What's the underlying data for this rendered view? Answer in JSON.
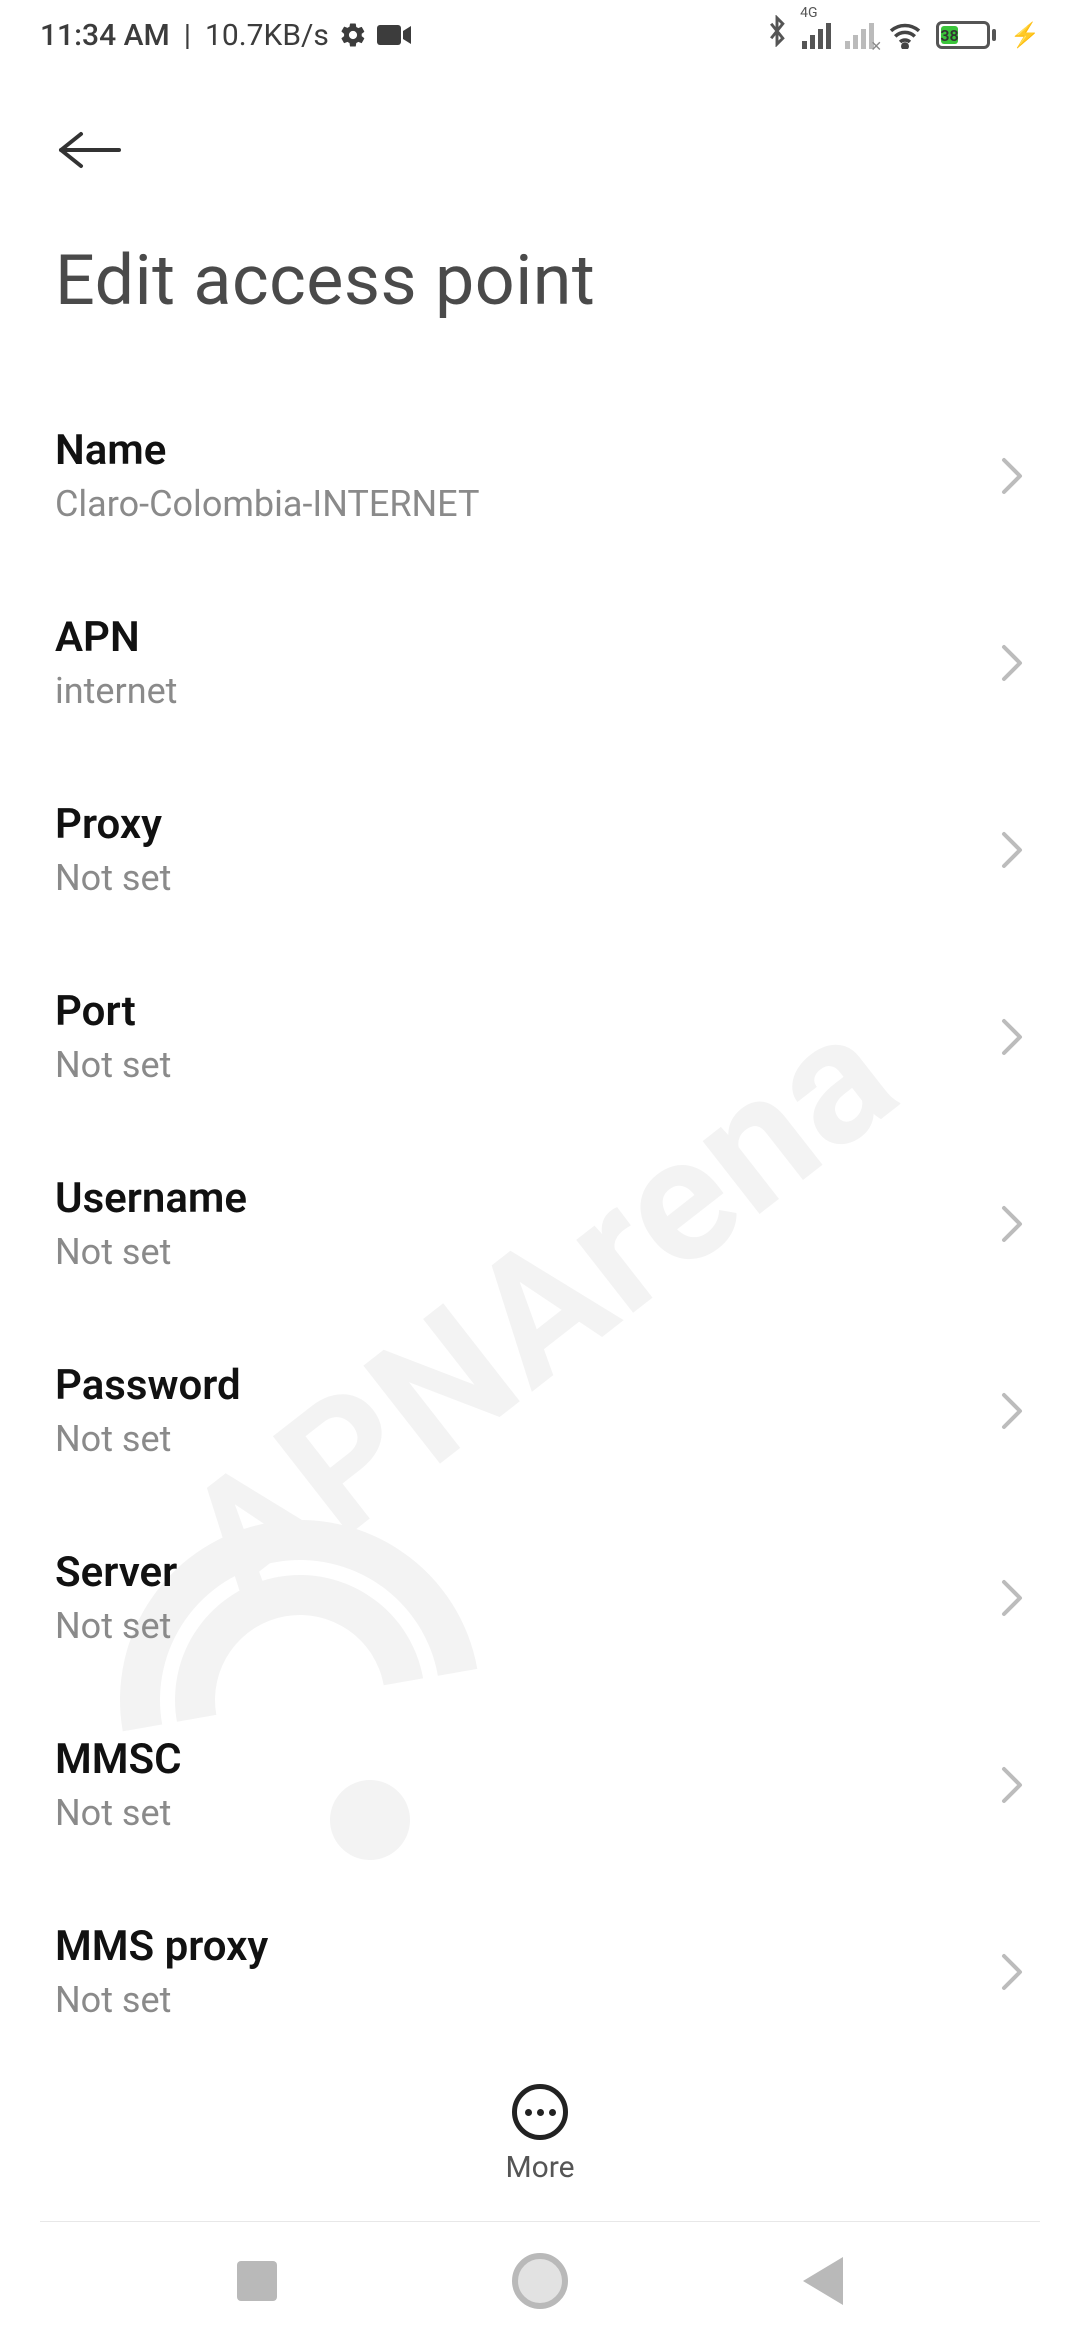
{
  "status": {
    "time": "11:34 AM",
    "speed": "10.7KB/s",
    "network_tag": "4G",
    "battery_pct": "38"
  },
  "header": {
    "title": "Edit access point"
  },
  "settings": {
    "items": [
      {
        "label": "Name",
        "value": "Claro-Colombia-INTERNET"
      },
      {
        "label": "APN",
        "value": "internet"
      },
      {
        "label": "Proxy",
        "value": "Not set"
      },
      {
        "label": "Port",
        "value": "Not set"
      },
      {
        "label": "Username",
        "value": "Not set"
      },
      {
        "label": "Password",
        "value": "Not set"
      },
      {
        "label": "Server",
        "value": "Not set"
      },
      {
        "label": "MMSC",
        "value": "Not set"
      },
      {
        "label": "MMS proxy",
        "value": "Not set"
      }
    ]
  },
  "more": {
    "label": "More"
  },
  "watermark": "APNArena"
}
